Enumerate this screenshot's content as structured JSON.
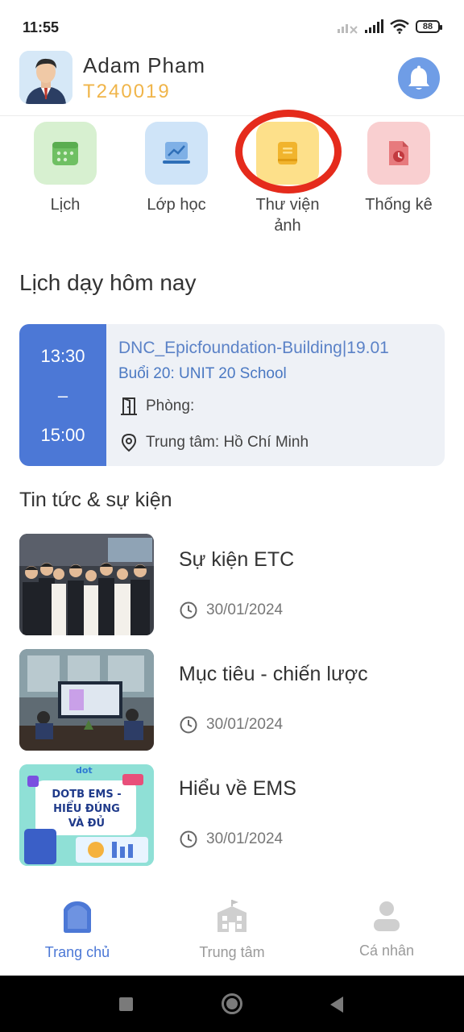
{
  "status": {
    "time": "11:55",
    "battery": "88"
  },
  "user": {
    "name": "Adam Pham",
    "code": "T240019"
  },
  "menu": [
    {
      "label": "Lịch"
    },
    {
      "label": "Lớp học"
    },
    {
      "label": "Thư viện ảnh"
    },
    {
      "label": "Thống kê"
    }
  ],
  "schedule": {
    "title": "Lịch dạy hôm nay",
    "start": "13:30",
    "separator": "–",
    "end": "15:00",
    "class_name": "DNC_Epicfoundation-Building|19.01",
    "lesson": "Buổi 20: UNIT 20 School",
    "room_label": "Phòng:",
    "center_label": "Trung tâm: Hồ Chí Minh"
  },
  "news": {
    "title": "Tin tức & sự kiện",
    "items": [
      {
        "title": "Sự kiện ETC",
        "date": "30/01/2024"
      },
      {
        "title": "Mục tiêu - chiến lược",
        "date": "30/01/2024"
      },
      {
        "title": "Hiểu về EMS",
        "date": "30/01/2024"
      }
    ],
    "banner_brand": "dot",
    "banner_text_1": "DOTB EMS -",
    "banner_text_2": "HIỂU ĐÚNG",
    "banner_text_3": "VÀ ĐỦ"
  },
  "nav": [
    {
      "label": "Trang chủ",
      "active": true
    },
    {
      "label": "Trung tâm",
      "active": false
    },
    {
      "label": "Cá nhân",
      "active": false
    }
  ],
  "colors": {
    "primary": "#4c78d6",
    "accent": "#f0b54a",
    "highlight": "#e52b1c"
  }
}
